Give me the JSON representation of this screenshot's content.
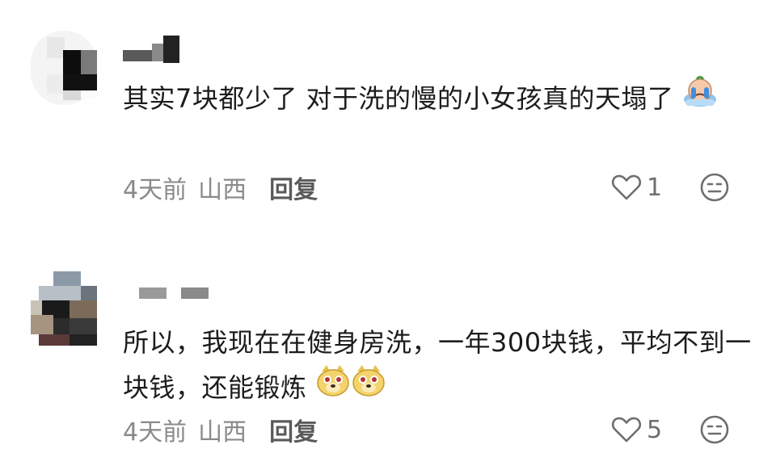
{
  "comments": [
    {
      "text": "其实7块都少了 对于洗的慢的小女孩真的天塌了",
      "time": "4天前",
      "location": "山西",
      "reply_label": "回复",
      "likes": "1",
      "emoji_names": [
        "crying-emoji"
      ]
    },
    {
      "text": "所以，我现在在健身房洗，一年300块钱，平均不到一块钱，还能锻炼",
      "time": "4天前",
      "location": "山西",
      "reply_label": "回复",
      "likes": "5",
      "emoji_names": [
        "doge-face-emoji",
        "doge-face-emoji"
      ]
    }
  ],
  "icons": {
    "like": "heart-outline-icon",
    "more": "expressionless-face-icon"
  },
  "colors": {
    "text": "#1c1c1c",
    "meta": "#8a8a8a",
    "reply": "#5a5a5a"
  }
}
